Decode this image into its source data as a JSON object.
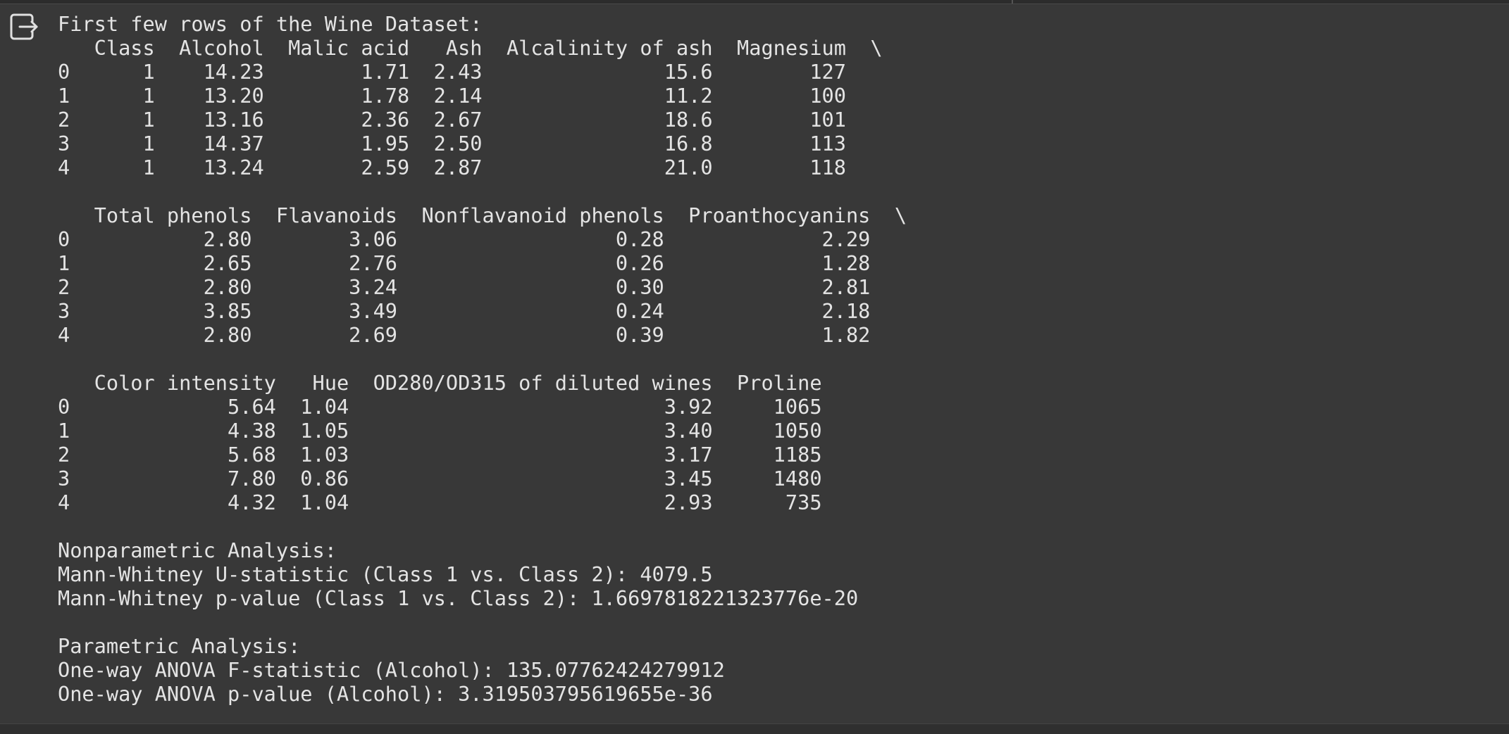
{
  "output": {
    "lines": [
      "First few rows of the Wine Dataset:",
      "   Class  Alcohol  Malic acid   Ash  Alcalinity of ash  Magnesium  \\",
      "0      1    14.23        1.71  2.43               15.6        127",
      "1      1    13.20        1.78  2.14               11.2        100",
      "2      1    13.16        2.36  2.67               18.6        101",
      "3      1    14.37        1.95  2.50               16.8        113",
      "4      1    13.24        2.59  2.87               21.0        118",
      "",
      "   Total phenols  Flavanoids  Nonflavanoid phenols  Proanthocyanins  \\",
      "0           2.80        3.06                  0.28             2.29",
      "1           2.65        2.76                  0.26             1.28",
      "2           2.80        3.24                  0.30             2.81",
      "3           3.85        3.49                  0.24             2.18",
      "4           2.80        2.69                  0.39             1.82",
      "",
      "   Color intensity   Hue  OD280/OD315 of diluted wines  Proline",
      "0             5.64  1.04                          3.92     1065",
      "1             4.38  1.05                          3.40     1050",
      "2             5.68  1.03                          3.17     1185",
      "3             7.80  0.86                          3.45     1480",
      "4             4.32  1.04                          2.93      735",
      "",
      "Nonparametric Analysis:",
      "Mann-Whitney U-statistic (Class 1 vs. Class 2): 4079.5",
      "Mann-Whitney p-value (Class 1 vs. Class 2): 1.6697818221323776e-20",
      "",
      "Parametric Analysis:",
      "One-way ANOVA F-statistic (Alcohol): 135.07762424279912",
      "One-way ANOVA p-value (Alcohol): 3.319503795619655e-36"
    ]
  },
  "icons": {
    "output_toggle": "output-exit-icon"
  },
  "colors": {
    "background": "#383838",
    "text": "#e4e4e4"
  }
}
